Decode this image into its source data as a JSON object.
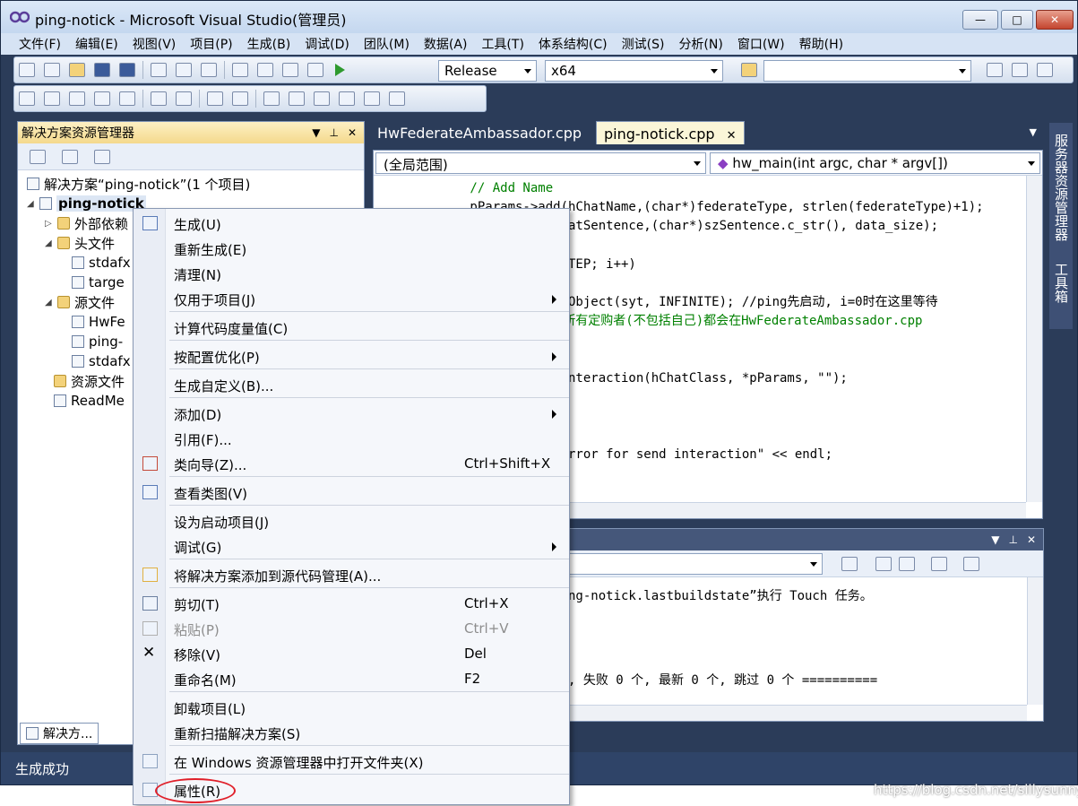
{
  "window": {
    "title": "ping-notick - Microsoft Visual Studio(管理员)",
    "buttons": {
      "minimize": "—",
      "maximize": "□",
      "close": "✕"
    }
  },
  "menubar": [
    "文件(F)",
    "编辑(E)",
    "视图(V)",
    "项目(P)",
    "生成(B)",
    "调试(D)",
    "团队(M)",
    "数据(A)",
    "工具(T)",
    "体系结构(C)",
    "测试(S)",
    "分析(N)",
    "窗口(W)",
    "帮助(H)"
  ],
  "toolbar": {
    "configuration": "Release",
    "platform": "x64",
    "find": ""
  },
  "solution_explorer": {
    "title": "解决方案资源管理器",
    "solution_label": "解决方案“ping-notick”(1 个项目)",
    "project": "ping-notick",
    "items": [
      {
        "label": "外部依赖"
      },
      {
        "label": "头文件"
      },
      {
        "label": "stdafx"
      },
      {
        "label": "targe"
      },
      {
        "label": "源文件"
      },
      {
        "label": "HwFe"
      },
      {
        "label": "ping-"
      },
      {
        "label": "stdafx"
      },
      {
        "label": "资源文件"
      },
      {
        "label": "ReadMe"
      }
    ],
    "bottom_tab": "解决方..."
  },
  "editor": {
    "tabs": [
      "HwFederateAmbassador.cpp",
      "ping-notick.cpp"
    ],
    "scope_left": "(全局范围)",
    "scope_right": "hw_main(int argc, char * argv[])",
    "lines": [
      {
        "text": "        // Add Name",
        "cls": "cm"
      },
      {
        "text": "        pParams->add(hChatName,(char*)federateType, strlen(federateType)+1);",
        "cls": ""
      },
      {
        "text": "                d(hChatSentence,(char*)szSentence.c_str(), data_size);",
        "cls": ""
      },
      {
        "text": "",
        "cls": ""
      },
      {
        "text": "                ; i<STEP; i++)",
        "cls": ""
      },
      {
        "text": "",
        "cls": ""
      },
      {
        "text": "               SingleObject(syt, INFINITE); //ping先启动, i=0时在这里等待",
        "cls": ""
      },
      {
        "text": "               交互, 所有定购者(不包括自己)都会在HwFederateAmbassador.cpp",
        "cls": "cm"
      },
      {
        "text": "",
        "cls": ""
      },
      {
        "text": "",
        "cls": ""
      },
      {
        "text": "                sendInteraction(hChatClass, *pParams, \"\");",
        "cls": ""
      },
      {
        "text": "",
        "cls": ""
      },
      {
        "text": "               .)",
        "cls": ""
      },
      {
        "text": "",
        "cls": ""
      },
      {
        "text": "              r << \"error for send interaction\" << endl;",
        "cls": ""
      }
    ]
  },
  "output": {
    "lines": [
      "ng-notick.lastbuildstate”执行 Touch 任务。",
      ", 失败 0 个, 最新 0 个, 跳过 0 个 =========="
    ]
  },
  "right_toolbar": {
    "server_explorer": "服务器资源管理器",
    "toolbox": "工具箱"
  },
  "status": "生成成功",
  "context_menu": [
    {
      "label": "生成(U)",
      "shortcut": "",
      "submenu": false,
      "disabled": false,
      "icon": "build-icon"
    },
    {
      "label": "重新生成(E)",
      "shortcut": "",
      "submenu": false,
      "disabled": false,
      "icon": ""
    },
    {
      "label": "清理(N)",
      "shortcut": "",
      "submenu": false,
      "disabled": false,
      "icon": ""
    },
    {
      "label": "仅用于项目(J)",
      "shortcut": "",
      "submenu": true,
      "disabled": false,
      "icon": ""
    },
    {
      "label": "计算代码度量值(C)",
      "shortcut": "",
      "submenu": false,
      "disabled": false,
      "icon": ""
    },
    {
      "label": "按配置优化(P)",
      "shortcut": "",
      "submenu": true,
      "disabled": false,
      "icon": ""
    },
    {
      "label": "生成自定义(B)...",
      "shortcut": "",
      "submenu": false,
      "disabled": false,
      "icon": ""
    },
    {
      "label": "添加(D)",
      "shortcut": "",
      "submenu": true,
      "disabled": false,
      "icon": ""
    },
    {
      "label": "引用(F)...",
      "shortcut": "",
      "submenu": false,
      "disabled": false,
      "icon": ""
    },
    {
      "label": "类向导(Z)...",
      "shortcut": "Ctrl+Shift+X",
      "submenu": false,
      "disabled": false,
      "icon": "class-wizard-icon"
    },
    {
      "label": "查看类图(V)",
      "shortcut": "",
      "submenu": false,
      "disabled": false,
      "icon": "class-diagram-icon"
    },
    {
      "label": "设为启动项目(J)",
      "shortcut": "",
      "submenu": false,
      "disabled": false,
      "icon": ""
    },
    {
      "label": "调试(G)",
      "shortcut": "",
      "submenu": true,
      "disabled": false,
      "icon": ""
    },
    {
      "label": "将解决方案添加到源代码管理(A)...",
      "shortcut": "",
      "submenu": false,
      "disabled": false,
      "icon": "source-control-add-icon"
    },
    {
      "label": "剪切(T)",
      "shortcut": "Ctrl+X",
      "submenu": false,
      "disabled": false,
      "icon": "scissors-icon"
    },
    {
      "label": "粘贴(P)",
      "shortcut": "Ctrl+V",
      "submenu": false,
      "disabled": true,
      "icon": "paste-icon"
    },
    {
      "label": "移除(V)",
      "shortcut": "Del",
      "submenu": false,
      "disabled": false,
      "icon": "remove-x-icon"
    },
    {
      "label": "重命名(M)",
      "shortcut": "F2",
      "submenu": false,
      "disabled": false,
      "icon": ""
    },
    {
      "label": "卸载项目(L)",
      "shortcut": "",
      "submenu": false,
      "disabled": false,
      "icon": ""
    },
    {
      "label": "重新扫描解决方案(S)",
      "shortcut": "",
      "submenu": false,
      "disabled": false,
      "icon": ""
    },
    {
      "label": "在 Windows 资源管理器中打开文件夹(X)",
      "shortcut": "",
      "submenu": false,
      "disabled": false,
      "icon": "open-folder-icon"
    },
    {
      "label": "属性(R)",
      "shortcut": "",
      "submenu": false,
      "disabled": false,
      "icon": "properties-icon"
    }
  ],
  "watermark": "https://blog.csdn.net/sillysunny"
}
